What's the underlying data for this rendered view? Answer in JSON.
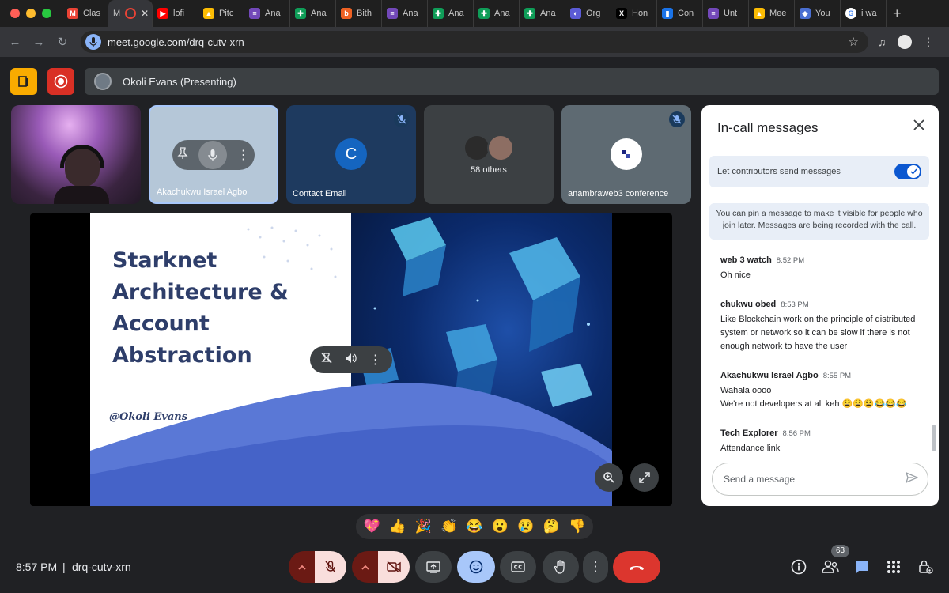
{
  "browser": {
    "traffic_colors": [
      "#ff5f57",
      "#febc2e",
      "#28c840"
    ],
    "tabs": [
      {
        "label": "Clas",
        "icon": "gmail-icon",
        "color": "#ea4335",
        "glyph": "M"
      },
      {
        "label": "M",
        "icon": "meet-recording-icon",
        "color": "#ea4335",
        "glyph": "",
        "active": true
      },
      {
        "label": "lofi",
        "icon": "youtube-icon",
        "color": "#ff0000",
        "glyph": "▶"
      },
      {
        "label": "Pitc",
        "icon": "google-drive-icon",
        "color": "#fbbc04",
        "glyph": "▲"
      },
      {
        "label": "Ana",
        "icon": "google-forms-icon",
        "color": "#7248b9",
        "glyph": "≡"
      },
      {
        "label": "Ana",
        "icon": "google-sheets-icon",
        "color": "#0f9d58",
        "glyph": "✚"
      },
      {
        "label": "Bith",
        "icon": "bitly-icon",
        "color": "#ee6123",
        "glyph": "b"
      },
      {
        "label": "Ana",
        "icon": "google-forms-icon",
        "color": "#7248b9",
        "glyph": "≡"
      },
      {
        "label": "Ana",
        "icon": "google-sheets-icon",
        "color": "#0f9d58",
        "glyph": "✚"
      },
      {
        "label": "Ana",
        "icon": "google-sheets-icon",
        "color": "#0f9d58",
        "glyph": "✚"
      },
      {
        "label": "Ana",
        "icon": "google-sheets-icon",
        "color": "#0f9d58",
        "glyph": "✚"
      },
      {
        "label": "Org",
        "icon": "org-icon",
        "color": "#5b5bd6",
        "glyph": "◐"
      },
      {
        "label": "Hon",
        "icon": "x-icon",
        "color": "#000000",
        "glyph": "X"
      },
      {
        "label": "Con",
        "icon": "analytics-icon",
        "color": "#1a73e8",
        "glyph": "▮"
      },
      {
        "label": "Unt",
        "icon": "google-forms-icon",
        "color": "#7248b9",
        "glyph": "≡"
      },
      {
        "label": "Mee",
        "icon": "google-drive-icon",
        "color": "#fbbc04",
        "glyph": "▲"
      },
      {
        "label": "You",
        "icon": "app-icon",
        "color": "#4a6fd1",
        "glyph": "◆"
      },
      {
        "label": "i wa",
        "icon": "google-icon",
        "color": "#ffffff",
        "glyph": "G"
      }
    ],
    "url": "meet.google.com/drq-cutv-xrn"
  },
  "meet": {
    "presenter_label": "Okoli Evans (Presenting)",
    "tiles": [
      {
        "name": ""
      },
      {
        "name": "Akachukwu Israel Agbo"
      },
      {
        "name": "Contact Email",
        "initial": "C"
      },
      {
        "name": "",
        "others": "58 others"
      },
      {
        "name": "anambraweb3 conference"
      }
    ],
    "slide": {
      "title_lines": [
        "Starknet",
        "Architecture &",
        "Account",
        "Abstraction"
      ],
      "author": "@Okoli Evans"
    }
  },
  "chat": {
    "title": "In-call messages",
    "toggle_label": "Let contributors send messages",
    "toggle_on": true,
    "info": "You can pin a message to make it visible for people who join later. Messages are being recorded with the call.",
    "messages": [
      {
        "sender": "web 3 watch",
        "time": "8:52 PM",
        "text": "Oh nice",
        "text2": ""
      },
      {
        "sender": "chukwu obed",
        "time": "8:53 PM",
        "text": "Like Blockchain work on the principle of distributed system or network so it can be slow if there is not enough network to have the user",
        "text2": ""
      },
      {
        "sender": "Akachukwu Israel Agbo",
        "time": "8:55 PM",
        "text": "Wahala oooo",
        "text2": "We're not developers at all keh 😩😩😩😂😂😂"
      },
      {
        "sender": "Tech Explorer",
        "time": "8:56 PM",
        "text": "Attendance link",
        "text2": ""
      }
    ],
    "input_placeholder": "Send a message"
  },
  "reactions": [
    "💖",
    "👍",
    "🎉",
    "👏",
    "😂",
    "😮",
    "😢",
    "🤔",
    "👎"
  ],
  "bottom": {
    "time": "8:57 PM",
    "separator": "|",
    "meeting_code": "drq-cutv-xrn",
    "people_count": "63"
  }
}
